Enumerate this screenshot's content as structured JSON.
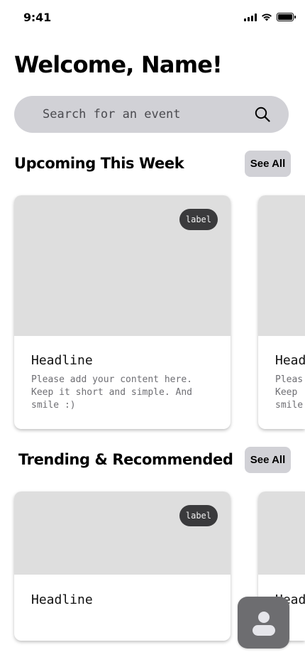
{
  "status_bar": {
    "time": "9:41",
    "icons": [
      "cellular-signal-icon",
      "wifi-icon",
      "battery-icon"
    ]
  },
  "header": {
    "title": "Welcome, Name!"
  },
  "search": {
    "placeholder": "Search for an event",
    "icon": "search-icon"
  },
  "sections": [
    {
      "title": "Upcoming This Week",
      "see_all_label": "See All",
      "cards": [
        {
          "label": "label",
          "headline": "Headline",
          "body_lines": [
            "Please add your content here.",
            "Keep it short and simple. And",
            "smile :)"
          ]
        },
        {
          "headline": "Head",
          "body_lines": [
            "Pleas",
            "Keep",
            "smile"
          ]
        }
      ]
    },
    {
      "title": "Trending & Recommended",
      "see_all_label": "See All",
      "cards": [
        {
          "label": "label",
          "headline": "Headline"
        },
        {
          "headline": "Head"
        }
      ]
    }
  ],
  "fab": {
    "icon": "person-icon"
  },
  "colors": {
    "search_bg": "#d1d1d6",
    "card_image": "#dedede",
    "label_bg": "#3a3a3c",
    "fab_bg": "#6d6d70"
  }
}
